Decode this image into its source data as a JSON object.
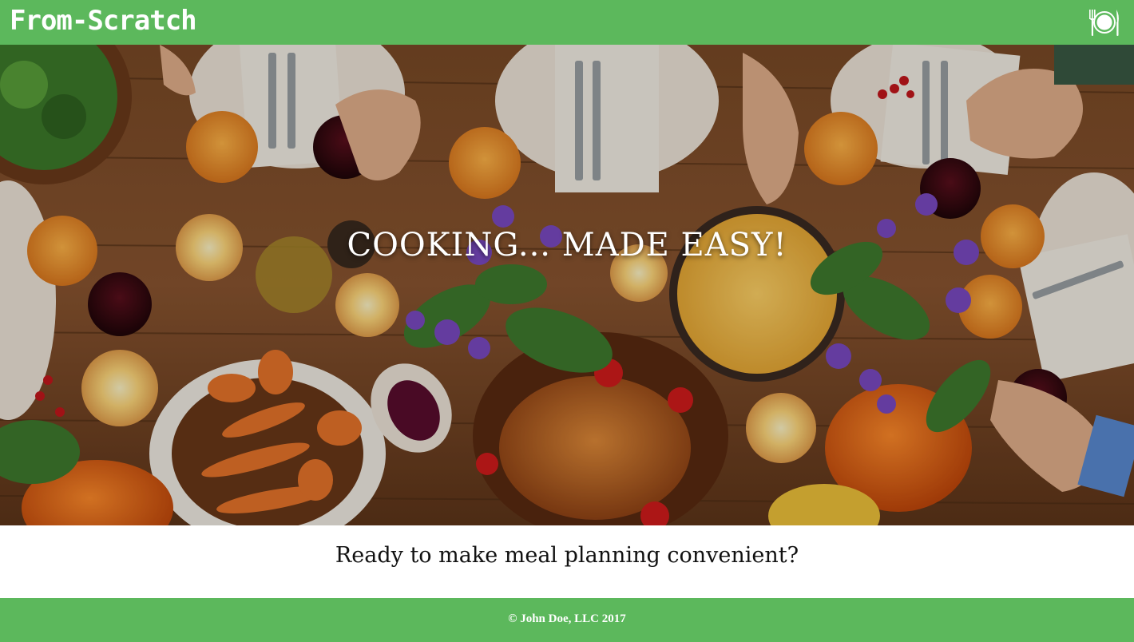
{
  "navbar": {
    "brand": "From-Scratch",
    "icon": "plate-fork-knife-icon"
  },
  "hero": {
    "title": "COOKING... MADE EASY!",
    "image": "overhead-dinner-table-photo"
  },
  "main": {
    "tagline": "Ready to make meal planning convenient?"
  },
  "footer": {
    "copyright": "© John Doe, LLC 2017"
  },
  "colors": {
    "brand_green": "#5cb85c",
    "text_white": "#ffffff",
    "text_dark": "#111111"
  }
}
